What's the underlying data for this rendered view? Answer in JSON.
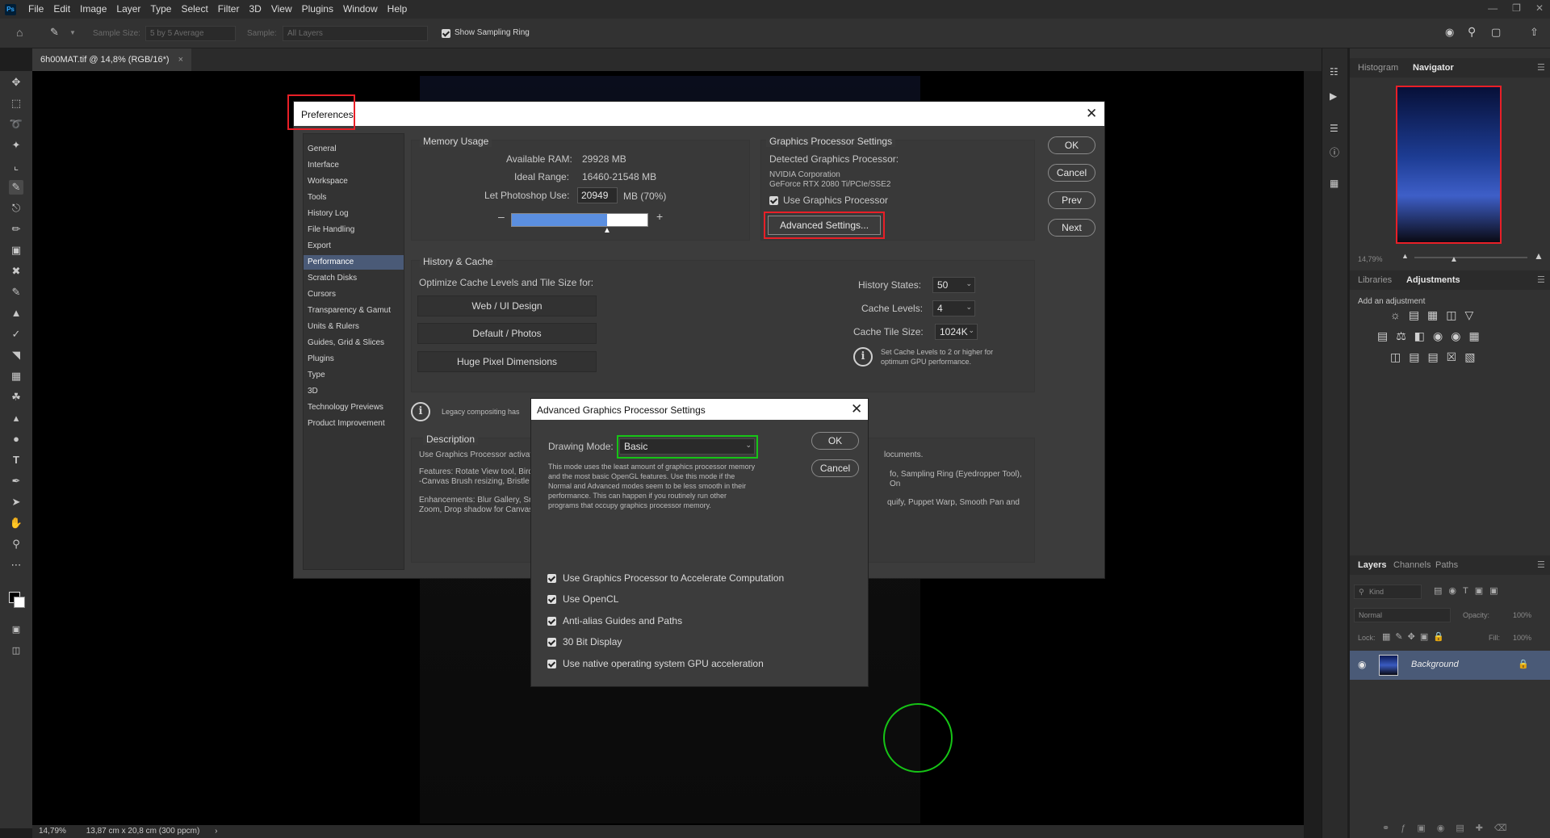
{
  "app": {
    "menu": [
      "File",
      "Edit",
      "Image",
      "Layer",
      "Type",
      "Select",
      "Filter",
      "3D",
      "View",
      "Plugins",
      "Window",
      "Help"
    ],
    "logo": "Ps"
  },
  "options_bar": {
    "sample_size_label": "Sample Size:",
    "sample_size_value": "5 by 5 Average",
    "sample_label": "Sample:",
    "sample_value": "All Layers",
    "show_ring_label": "Show Sampling Ring"
  },
  "document_tab": {
    "title": "6h00MAT.tif @ 14,8% (RGB/16*)",
    "close": "×"
  },
  "status_bar": {
    "zoom": "14,79%",
    "size": "13,87 cm x 20,8 cm (300 ppcm)",
    "arrow": "›"
  },
  "right_panels": {
    "top_tabs": [
      "Histogram",
      "Navigator"
    ],
    "zoom": "14,79%",
    "mid_tabs": [
      "Libraries",
      "Adjustments"
    ],
    "add_adjustment": "Add an adjustment",
    "layer_tabs": [
      "Layers",
      "Channels",
      "Paths"
    ],
    "kind": "Kind",
    "blend_mode": "Normal",
    "opacity_label": "Opacity:",
    "opacity_value": "100%",
    "lock_label": "Lock:",
    "fill_label": "Fill:",
    "fill_value": "100%",
    "layer_name": "Background"
  },
  "preferences": {
    "title": "Preferences",
    "nav": [
      "General",
      "Interface",
      "Workspace",
      "Tools",
      "History Log",
      "File Handling",
      "Export",
      "Performance",
      "Scratch Disks",
      "Cursors",
      "Transparency & Gamut",
      "Units & Rulers",
      "Guides, Grid & Slices",
      "Plugins",
      "Type",
      "3D",
      "Technology Previews",
      "Product Improvement"
    ],
    "selected_nav": "Performance",
    "memory": {
      "title": "Memory Usage",
      "available_label": "Available RAM:",
      "available_value": "29928 MB",
      "ideal_label": "Ideal Range:",
      "ideal_value": "16460-21548 MB",
      "let_label": "Let Photoshop Use:",
      "let_value": "20949",
      "let_unit": "MB (70%)",
      "minus": "–",
      "plus": "+",
      "slider_fraction": 0.7
    },
    "gpu": {
      "title": "Graphics Processor Settings",
      "detected_label": "Detected Graphics Processor:",
      "vendor": "NVIDIA Corporation",
      "model": "GeForce RTX 2080 Ti/PCIe/SSE2",
      "use_gpu": "Use Graphics Processor",
      "advanced_button": "Advanced Settings..."
    },
    "buttons": {
      "ok": "OK",
      "cancel": "Cancel",
      "prev": "Prev",
      "next": "Next"
    },
    "history_cache": {
      "title": "History & Cache",
      "optimize_label": "Optimize Cache Levels and Tile Size for:",
      "presets": [
        "Web / UI Design",
        "Default / Photos",
        "Huge Pixel Dimensions"
      ],
      "history_states_label": "History States:",
      "history_states_value": "50",
      "cache_levels_label": "Cache Levels:",
      "cache_levels_value": "4",
      "tile_size_label": "Cache Tile Size:",
      "tile_size_value": "1024K",
      "tip_line1": "Set Cache Levels to 2 or higher for",
      "tip_line2": "optimum GPU performance."
    },
    "legacy_text": "Legacy compositing has",
    "description": {
      "title": "Description",
      "left_line1": "Use Graphics Processor activat",
      "left_line2": "Features: Rotate View tool, Bird",
      "left_line3": "-Canvas Brush resizing, Bristle",
      "left_line4": "Enhancements: Blur Gallery, Sr",
      "left_line5": "Zoom, Drop shadow for Canvas",
      "right_line1": "locuments.",
      "right_line2": "fo, Sampling Ring (Eyedropper Tool), On",
      "right_line3": "quify, Puppet Warp, Smooth Pan and"
    }
  },
  "advanced_dialog": {
    "title": "Advanced Graphics Processor Settings",
    "drawing_mode_label": "Drawing Mode:",
    "drawing_mode_value": "Basic",
    "mode_desc1": "This mode uses the least amount of graphics processor memory",
    "mode_desc2": "and the most basic OpenGL features.  Use this mode if the",
    "mode_desc3": "Normal and Advanced modes seem to be less smooth in their",
    "mode_desc4": "performance.  This can happen if you routinely run other",
    "mode_desc5": "programs that occupy graphics processor memory.",
    "ok": "OK",
    "cancel": "Cancel",
    "options": [
      "Use Graphics Processor to Accelerate Computation",
      "Use OpenCL",
      "Anti-alias Guides and Paths",
      "30 Bit Display",
      "Use native operating system GPU acceleration"
    ]
  },
  "colors": {
    "highlight_red": "#e81f27",
    "highlight_green": "#16c416",
    "selection": "#4a5a77",
    "slider_fill": "#5b8fe0"
  }
}
